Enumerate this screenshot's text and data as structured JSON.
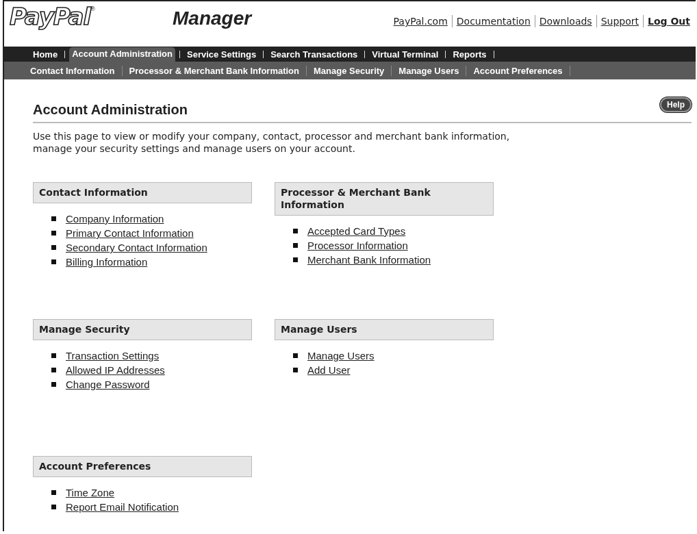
{
  "logo": {
    "name": "PayPal",
    "mark": "®"
  },
  "product": "Manager",
  "top_links": [
    {
      "label": "PayPal.com",
      "bold": false
    },
    {
      "label": "Documentation",
      "bold": false
    },
    {
      "label": "Downloads",
      "bold": false
    },
    {
      "label": "Support",
      "bold": false
    },
    {
      "label": "Log Out",
      "bold": true
    }
  ],
  "nav": [
    {
      "label": "Home",
      "selected": false
    },
    {
      "label": "Account Administration",
      "selected": true
    },
    {
      "label": "Service Settings",
      "selected": false
    },
    {
      "label": "Search Transactions",
      "selected": false
    },
    {
      "label": "Virtual Terminal",
      "selected": false
    },
    {
      "label": "Reports",
      "selected": false
    }
  ],
  "subnav": [
    "Contact Information",
    "Processor & Merchant Bank Information",
    "Manage Security",
    "Manage Users",
    "Account Preferences"
  ],
  "page": {
    "title": "Account Administration",
    "help": "Help",
    "description": "Use this page to view or modify your company, contact, processor and merchant bank information, manage your security settings and manage users on your account."
  },
  "sections": [
    {
      "title": "Contact Information",
      "links": [
        "Company Information",
        "Primary Contact Information",
        "Secondary Contact Information",
        "Billing Information"
      ]
    },
    {
      "title": "Processor & Merchant Bank Information",
      "links": [
        "Accepted Card Types",
        "Processor Information",
        "Merchant Bank Information"
      ]
    },
    {
      "title": "Manage Security",
      "links": [
        "Transaction Settings",
        "Allowed IP Addresses",
        "Change Password"
      ]
    },
    {
      "title": "Manage Users",
      "links": [
        "Manage Users",
        "Add User"
      ]
    },
    {
      "title": "Account Preferences",
      "links": [
        "Time Zone",
        "Report Email Notification"
      ]
    }
  ]
}
